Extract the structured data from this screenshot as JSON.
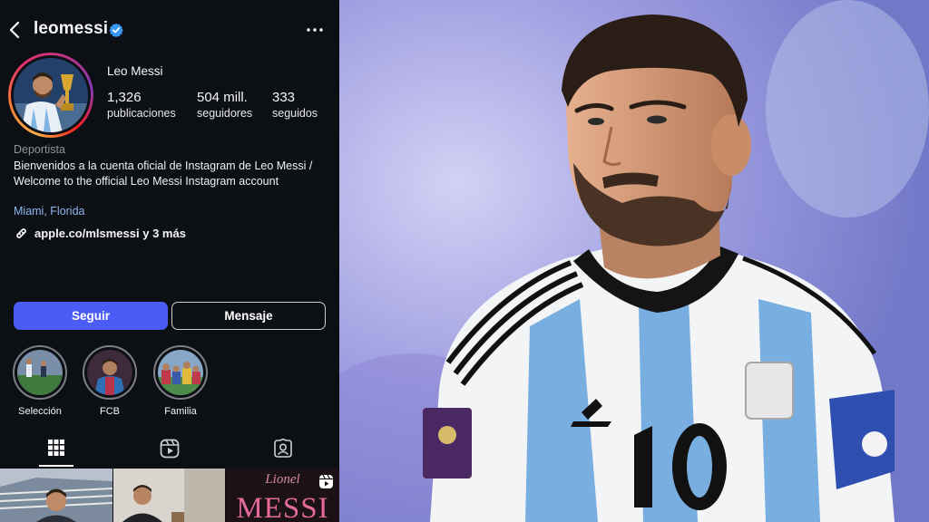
{
  "profile": {
    "username": "leomessi",
    "display_name": "Leo Messi",
    "stats": [
      {
        "value": "1,326",
        "label": "publicaciones"
      },
      {
        "value": "504 mill.",
        "label": "seguidores"
      },
      {
        "value": "333",
        "label": "seguidos"
      }
    ],
    "category": "Deportista",
    "bio": "Bienvenidos a la cuenta oficial de Instagram de Leo Messi / Welcome to the official Leo Messi Instagram account",
    "location": "Miami, Florida",
    "link": "apple.co/mlsmessi y 3 más"
  },
  "actions": {
    "follow": "Seguir",
    "message": "Mensaje"
  },
  "highlights": [
    {
      "label": "Selección"
    },
    {
      "label": "FCB"
    },
    {
      "label": "Familia"
    }
  ],
  "tabs": [
    {
      "icon": "grid-icon",
      "active": true
    },
    {
      "icon": "reels-icon",
      "active": false
    },
    {
      "icon": "tagged-icon",
      "active": false
    }
  ],
  "posts": {
    "third_small": "Lionel",
    "third_big": "MESSI"
  },
  "colors": {
    "panel_bg": "#0c0f14",
    "follow_button": "#4a5cf5",
    "verified_badge": "#3897f0",
    "location_link": "#8fb7ee"
  }
}
